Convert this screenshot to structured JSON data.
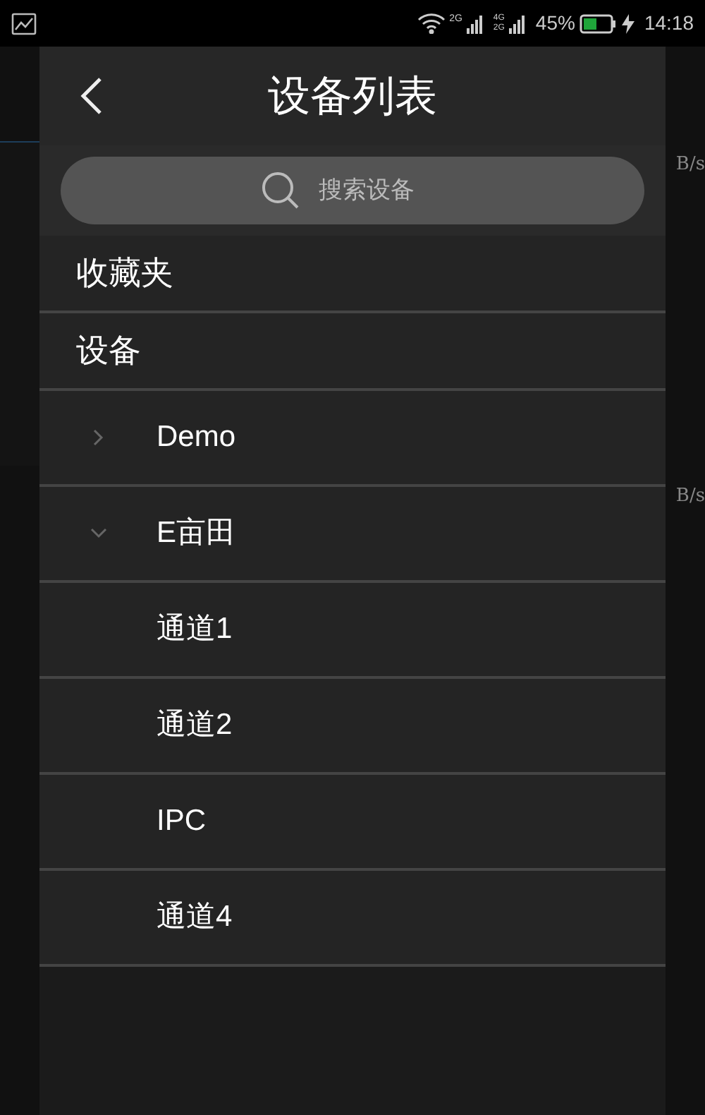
{
  "status_bar": {
    "sim1_label": "2G",
    "sim2_labels": [
      "4G",
      "2G"
    ],
    "battery": "45%",
    "time": "14:18"
  },
  "background": {
    "right_labels": [
      "B/s",
      "B/s"
    ]
  },
  "drawer": {
    "title": "设备列表",
    "search": {
      "placeholder": "搜索设备"
    },
    "sections": [
      {
        "label": "收藏夹"
      },
      {
        "label": "设备"
      }
    ],
    "devices": [
      {
        "label": "Demo",
        "expanded": false
      },
      {
        "label": "E亩田",
        "expanded": true,
        "children": [
          {
            "label": "通道1"
          },
          {
            "label": "通道2"
          },
          {
            "label": "IPC"
          },
          {
            "label": "通道4"
          }
        ]
      }
    ]
  }
}
